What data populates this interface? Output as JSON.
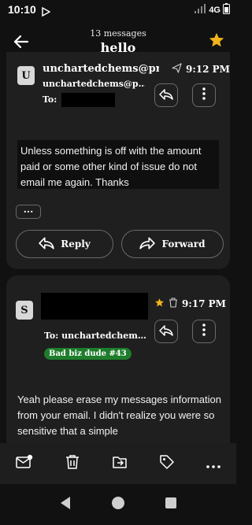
{
  "status": {
    "time": "10:10",
    "network": "4G"
  },
  "header": {
    "subtitle": "13 messages",
    "title": "hello",
    "accent": "#f2b41c"
  },
  "message1": {
    "avatar": "U",
    "from": "unchartedchems@pr…",
    "email": "unchartedchems@p…",
    "to_label": "To:",
    "time": "9:12 PM",
    "body": "Unless something is off with the amount paid or some other kind of issue do not email me again.  Thanks",
    "more_label": "···",
    "reply_label": "Reply",
    "forward_label": "Forward"
  },
  "message2": {
    "avatar": "S",
    "to_label": "To: unchartedchem…",
    "time": "9:17 PM",
    "badge": "Bad biz dude #43",
    "badge_color": "#1e7d2b",
    "body": "Yeah please erase my messages information from your email. I didn't realize you were so sensitive that a simple"
  },
  "toolbar": [
    "mark-unread-icon",
    "delete-icon",
    "move-icon",
    "label-icon",
    "more-icon"
  ],
  "navigation": [
    "back-nav-icon",
    "home-nav-icon",
    "recents-nav-icon"
  ]
}
